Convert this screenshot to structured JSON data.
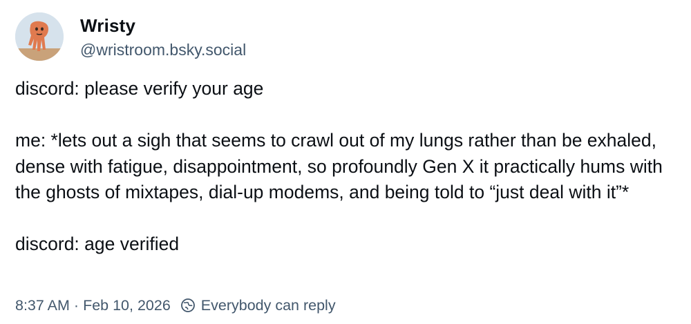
{
  "author": {
    "display_name": "Wristy",
    "handle": "@wristroom.bsky.social",
    "avatar_icon": "hand-avatar-icon"
  },
  "post": {
    "paragraphs": [
      "discord: please verify your age",
      "me: *lets out a sigh that seems to crawl out of my lungs rather than be exhaled, dense with fatigue, disappointment, so profoundly Gen X it practically hums with the ghosts of mixtapes, dial-up modems, and being told to “just deal with it”*",
      "discord: age verified"
    ]
  },
  "meta": {
    "time": "8:37 AM",
    "separator": "·",
    "date": "Feb 10, 2026",
    "reply_icon": "globe-reply-icon",
    "reply_setting": "Everybody can reply"
  },
  "colors": {
    "text": "#0b0f14",
    "secondary_text": "#42576c",
    "background": "#ffffff"
  }
}
